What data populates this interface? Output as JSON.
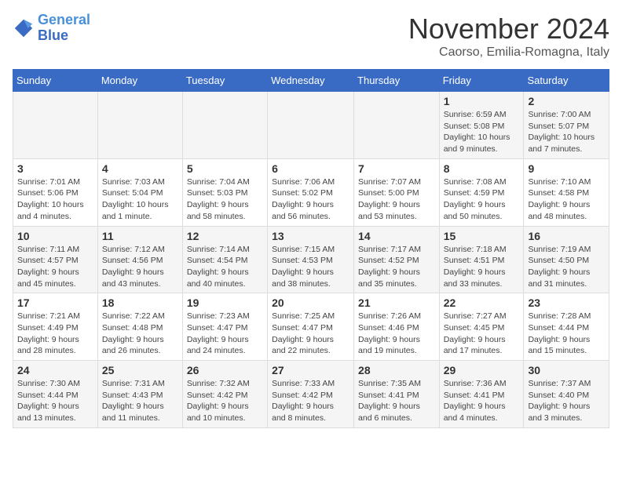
{
  "logo": {
    "line1": "General",
    "line2": "Blue"
  },
  "title": "November 2024",
  "location": "Caorso, Emilia-Romagna, Italy",
  "days_of_week": [
    "Sunday",
    "Monday",
    "Tuesday",
    "Wednesday",
    "Thursday",
    "Friday",
    "Saturday"
  ],
  "weeks": [
    [
      {
        "day": "",
        "detail": ""
      },
      {
        "day": "",
        "detail": ""
      },
      {
        "day": "",
        "detail": ""
      },
      {
        "day": "",
        "detail": ""
      },
      {
        "day": "",
        "detail": ""
      },
      {
        "day": "1",
        "detail": "Sunrise: 6:59 AM\nSunset: 5:08 PM\nDaylight: 10 hours and 9 minutes."
      },
      {
        "day": "2",
        "detail": "Sunrise: 7:00 AM\nSunset: 5:07 PM\nDaylight: 10 hours and 7 minutes."
      }
    ],
    [
      {
        "day": "3",
        "detail": "Sunrise: 7:01 AM\nSunset: 5:06 PM\nDaylight: 10 hours and 4 minutes."
      },
      {
        "day": "4",
        "detail": "Sunrise: 7:03 AM\nSunset: 5:04 PM\nDaylight: 10 hours and 1 minute."
      },
      {
        "day": "5",
        "detail": "Sunrise: 7:04 AM\nSunset: 5:03 PM\nDaylight: 9 hours and 58 minutes."
      },
      {
        "day": "6",
        "detail": "Sunrise: 7:06 AM\nSunset: 5:02 PM\nDaylight: 9 hours and 56 minutes."
      },
      {
        "day": "7",
        "detail": "Sunrise: 7:07 AM\nSunset: 5:00 PM\nDaylight: 9 hours and 53 minutes."
      },
      {
        "day": "8",
        "detail": "Sunrise: 7:08 AM\nSunset: 4:59 PM\nDaylight: 9 hours and 50 minutes."
      },
      {
        "day": "9",
        "detail": "Sunrise: 7:10 AM\nSunset: 4:58 PM\nDaylight: 9 hours and 48 minutes."
      }
    ],
    [
      {
        "day": "10",
        "detail": "Sunrise: 7:11 AM\nSunset: 4:57 PM\nDaylight: 9 hours and 45 minutes."
      },
      {
        "day": "11",
        "detail": "Sunrise: 7:12 AM\nSunset: 4:56 PM\nDaylight: 9 hours and 43 minutes."
      },
      {
        "day": "12",
        "detail": "Sunrise: 7:14 AM\nSunset: 4:54 PM\nDaylight: 9 hours and 40 minutes."
      },
      {
        "day": "13",
        "detail": "Sunrise: 7:15 AM\nSunset: 4:53 PM\nDaylight: 9 hours and 38 minutes."
      },
      {
        "day": "14",
        "detail": "Sunrise: 7:17 AM\nSunset: 4:52 PM\nDaylight: 9 hours and 35 minutes."
      },
      {
        "day": "15",
        "detail": "Sunrise: 7:18 AM\nSunset: 4:51 PM\nDaylight: 9 hours and 33 minutes."
      },
      {
        "day": "16",
        "detail": "Sunrise: 7:19 AM\nSunset: 4:50 PM\nDaylight: 9 hours and 31 minutes."
      }
    ],
    [
      {
        "day": "17",
        "detail": "Sunrise: 7:21 AM\nSunset: 4:49 PM\nDaylight: 9 hours and 28 minutes."
      },
      {
        "day": "18",
        "detail": "Sunrise: 7:22 AM\nSunset: 4:48 PM\nDaylight: 9 hours and 26 minutes."
      },
      {
        "day": "19",
        "detail": "Sunrise: 7:23 AM\nSunset: 4:47 PM\nDaylight: 9 hours and 24 minutes."
      },
      {
        "day": "20",
        "detail": "Sunrise: 7:25 AM\nSunset: 4:47 PM\nDaylight: 9 hours and 22 minutes."
      },
      {
        "day": "21",
        "detail": "Sunrise: 7:26 AM\nSunset: 4:46 PM\nDaylight: 9 hours and 19 minutes."
      },
      {
        "day": "22",
        "detail": "Sunrise: 7:27 AM\nSunset: 4:45 PM\nDaylight: 9 hours and 17 minutes."
      },
      {
        "day": "23",
        "detail": "Sunrise: 7:28 AM\nSunset: 4:44 PM\nDaylight: 9 hours and 15 minutes."
      }
    ],
    [
      {
        "day": "24",
        "detail": "Sunrise: 7:30 AM\nSunset: 4:44 PM\nDaylight: 9 hours and 13 minutes."
      },
      {
        "day": "25",
        "detail": "Sunrise: 7:31 AM\nSunset: 4:43 PM\nDaylight: 9 hours and 11 minutes."
      },
      {
        "day": "26",
        "detail": "Sunrise: 7:32 AM\nSunset: 4:42 PM\nDaylight: 9 hours and 10 minutes."
      },
      {
        "day": "27",
        "detail": "Sunrise: 7:33 AM\nSunset: 4:42 PM\nDaylight: 9 hours and 8 minutes."
      },
      {
        "day": "28",
        "detail": "Sunrise: 7:35 AM\nSunset: 4:41 PM\nDaylight: 9 hours and 6 minutes."
      },
      {
        "day": "29",
        "detail": "Sunrise: 7:36 AM\nSunset: 4:41 PM\nDaylight: 9 hours and 4 minutes."
      },
      {
        "day": "30",
        "detail": "Sunrise: 7:37 AM\nSunset: 4:40 PM\nDaylight: 9 hours and 3 minutes."
      }
    ]
  ]
}
